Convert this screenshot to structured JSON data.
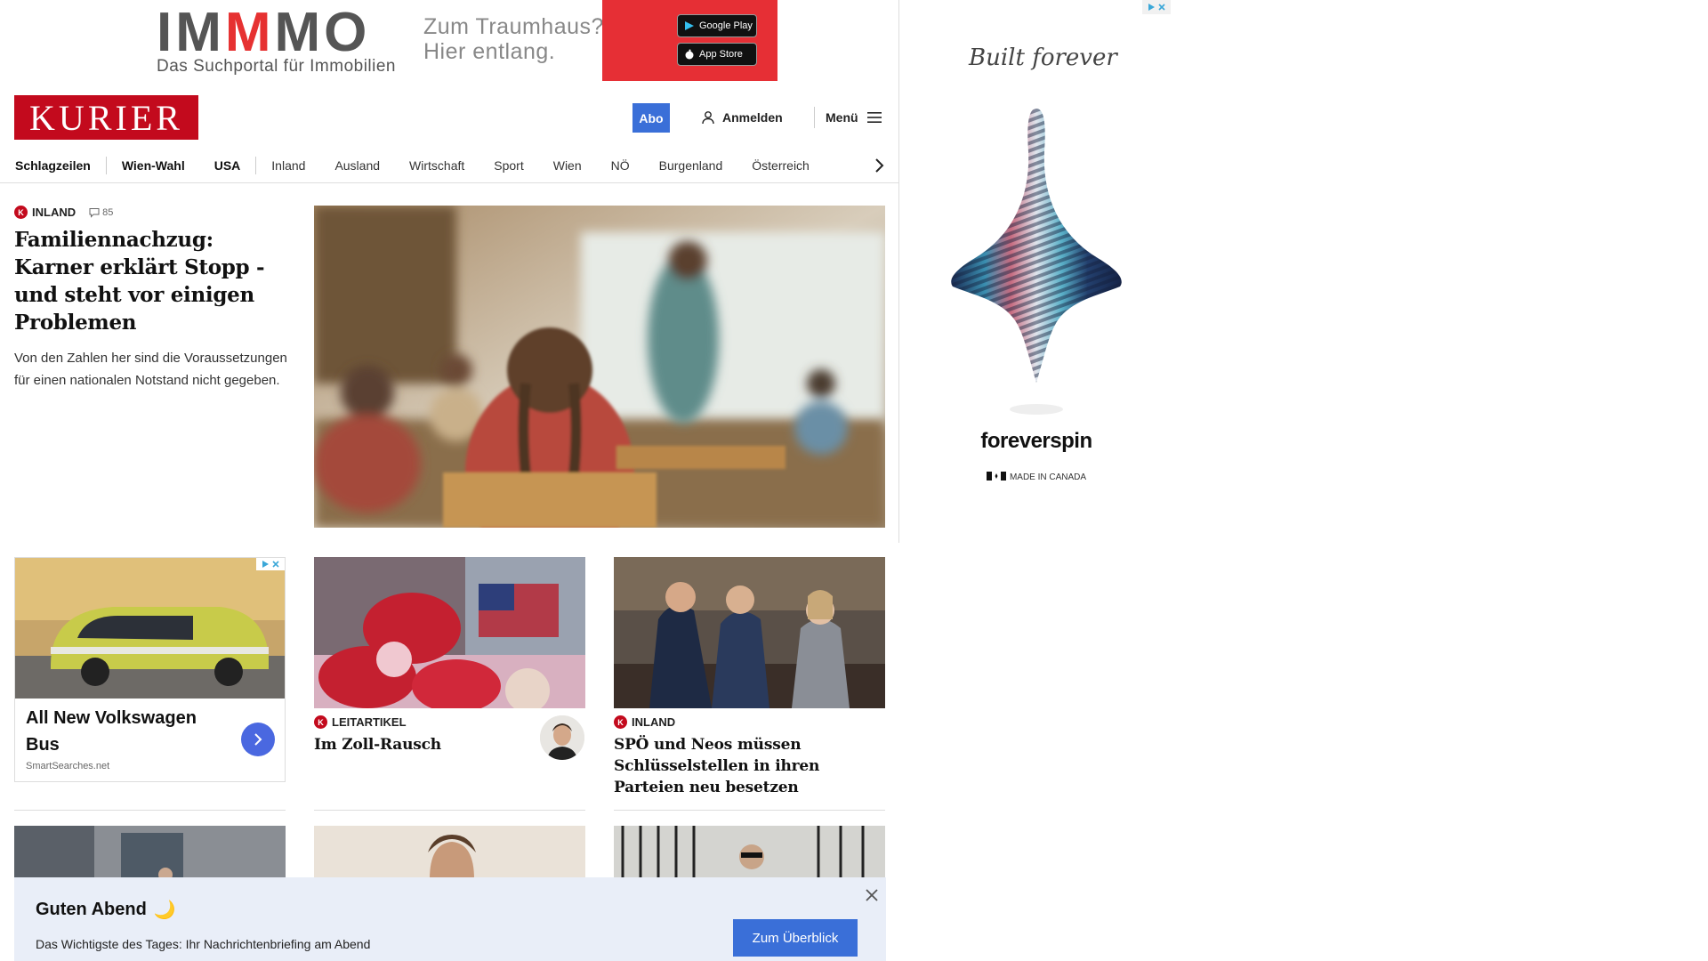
{
  "top_ad": {
    "logo_parts": [
      "IM",
      "M",
      "MO"
    ],
    "subline": "Das Suchportal für Immobilien",
    "claim_line1": "Zum Traumhaus?",
    "claim_line2": "Hier entlang.",
    "google_play": "Google Play",
    "app_store": "App Store",
    "accent_color": "#e62f35"
  },
  "header": {
    "logo": "KURIER",
    "abo": "Abo",
    "login": "Anmelden",
    "menu": "Menü",
    "brand_color": "#c30a1d"
  },
  "nav": {
    "items": [
      "Schlagzeilen",
      "Wien-Wahl",
      "USA",
      "Inland",
      "Ausland",
      "Wirtschaft",
      "Sport",
      "Wien",
      "NÖ",
      "Burgenland",
      "Österreich"
    ]
  },
  "lead": {
    "kicker": "Inland",
    "comments": "85",
    "headline": "Familiennachzug: Karner erklärt Stopp - und steht vor einigen Problemen",
    "teaser": "Von den Zahlen her sind die Voraussetzungen für einen nationalen Notstand nicht gegeben."
  },
  "ad_vw": {
    "title": "All New Volkswagen Bus",
    "source": "SmartSearches.net"
  },
  "cards": [
    {
      "kicker": "Leitartikel",
      "headline": "Im Zoll-Rausch"
    },
    {
      "kicker": "Inland",
      "headline": "SPÖ und Neos müssen Schlüsselstellen in ihren Parteien neu besetzen"
    }
  ],
  "side_ad": {
    "tagline": "Built forever",
    "brand": "foreverspin",
    "made_in": "MADE IN CANADA"
  },
  "briefing": {
    "greeting": "Guten Abend",
    "moon": "🌙",
    "description": "Das Wichtigste des Tages: Ihr Nachrichtenbriefing am Abend",
    "cta": "Zum Überblick",
    "background": "#e9eef8"
  }
}
